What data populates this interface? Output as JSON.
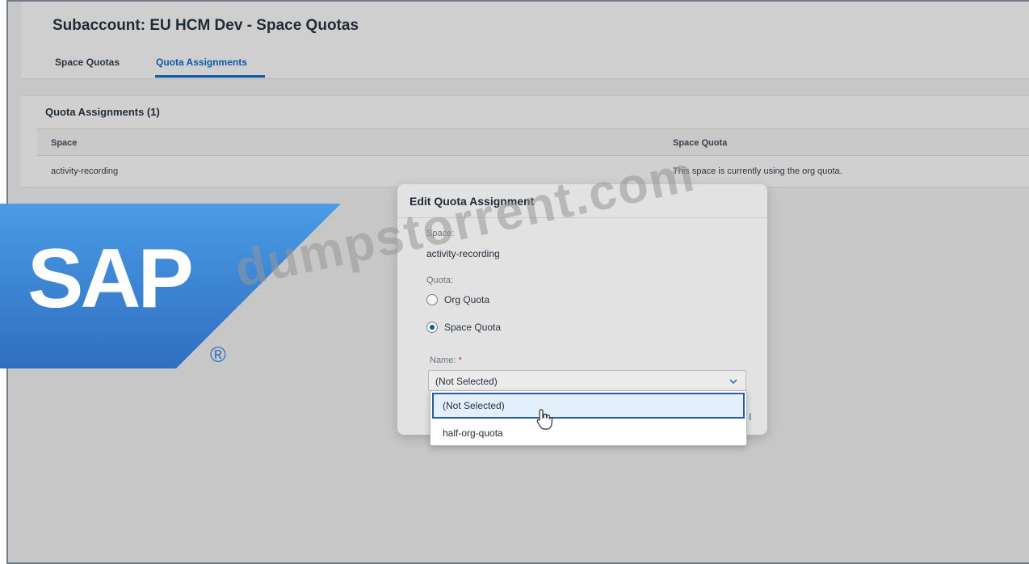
{
  "page": {
    "title": "Subaccount: EU HCM Dev - Space Quotas",
    "tabs": [
      {
        "label": "Space Quotas",
        "selected": false
      },
      {
        "label": "Quota Assignments",
        "selected": true
      }
    ]
  },
  "table": {
    "title": "Quota Assignments (1)",
    "columns": [
      "Space",
      "Space Quota"
    ],
    "rows": [
      {
        "space": "activity-recording",
        "space_quota": "This space is currently using the org quota."
      }
    ]
  },
  "dialog": {
    "title": "Edit Quota Assignment",
    "space_label": "Space:",
    "space_value": "activity-recording",
    "quota_label": "Quota:",
    "options": [
      {
        "label": "Org Quota",
        "selected": false
      },
      {
        "label": "Space Quota",
        "selected": true
      }
    ],
    "name_label": "Name:",
    "name_required_marker": "*",
    "select_value": "(Not Selected)",
    "footer_partial": "l"
  },
  "dropdown": {
    "items": [
      {
        "label": "(Not Selected)",
        "highlighted": true
      },
      {
        "label": "half-org-quota",
        "highlighted": false
      }
    ]
  },
  "overlay": {
    "logo_text": "SAP",
    "logo_registered": "®",
    "watermark": "dumpstorrent.com"
  },
  "colors": {
    "accent": "#0a5aa8",
    "logo_blue": "#3f86d6",
    "required": "#c0392b"
  }
}
